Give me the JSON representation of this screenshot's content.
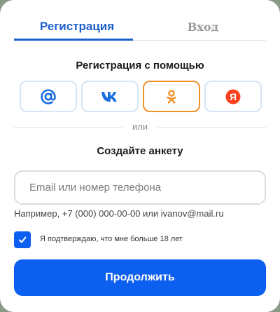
{
  "tabs": {
    "register_label": "Регистрация",
    "login_label": "Вход",
    "active": "register"
  },
  "social": {
    "heading": "Регистрация с помощью",
    "providers": [
      {
        "name": "mail-ru",
        "icon": "at-sign-icon",
        "color": "#1b6de0"
      },
      {
        "name": "vk",
        "icon": "vk-icon",
        "color": "#1b6de0"
      },
      {
        "name": "odnoklassniki",
        "icon": "ok-icon",
        "color": "#f0922a",
        "selected": true
      },
      {
        "name": "yandex",
        "icon": "yandex-icon",
        "color": "#fc3f1d",
        "glyph": "Я"
      }
    ]
  },
  "divider": {
    "text": "или"
  },
  "form": {
    "title": "Создайте анкету",
    "email_placeholder": "Email или номер телефона",
    "email_value": "",
    "hint": "Например, +7 (000) 000-00-00 или ivanov@mail.ru",
    "age_confirm_label": "Я подтверждаю, что мне больше 18 лет",
    "age_confirm_checked": true,
    "submit_label": "Продолжить"
  },
  "colors": {
    "accent": "#0d5ff0",
    "tab_active": "#1f5fc9",
    "ok_border": "#f0922a"
  }
}
